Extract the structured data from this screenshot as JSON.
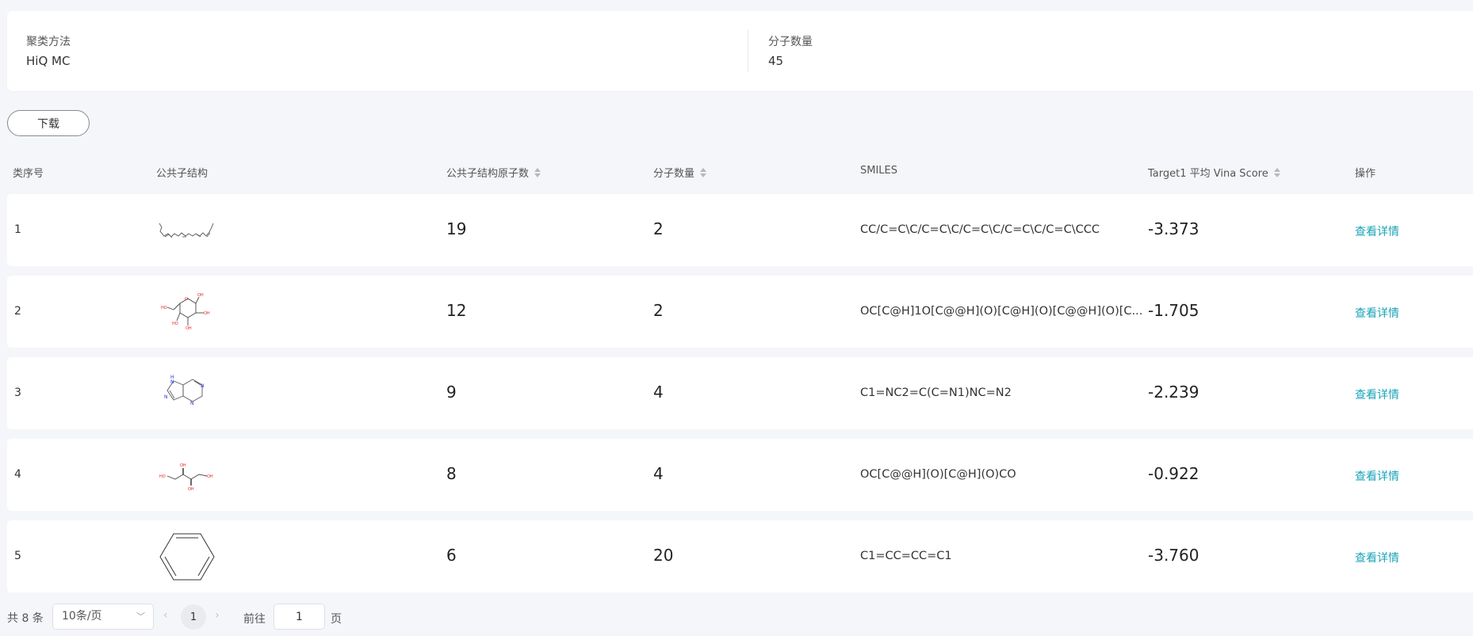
{
  "summary": {
    "method_label": "聚类方法",
    "method_value": "HiQ MC",
    "count_label": "分子数量",
    "count_value": "45"
  },
  "toolbar": {
    "download_label": "下载"
  },
  "table": {
    "headers": {
      "index": "类序号",
      "structure": "公共子结构",
      "atoms": "公共子结构原子数",
      "count": "分子数量",
      "smiles": "SMILES",
      "score": "Target1 平均 Vina Score",
      "action": "操作"
    },
    "rows": [
      {
        "index": "1",
        "structure_icon": "polyene-chain-structure",
        "atoms": "19",
        "count": "2",
        "smiles": "CC/C=C\\C/C=C\\C/C=C\\C/C=C\\C/C=C\\CCC",
        "score": "-3.373",
        "action": "查看详情"
      },
      {
        "index": "2",
        "structure_icon": "pyranose-ring-structure",
        "atoms": "12",
        "count": "2",
        "smiles": "OC[C@H]1O[C@@H](O)[C@H](O)[C@@H](O)[C...",
        "score": "-1.705",
        "action": "查看详情"
      },
      {
        "index": "3",
        "structure_icon": "purine-structure",
        "atoms": "9",
        "count": "4",
        "smiles": "C1=NC2=C(C=N1)NC=N2",
        "score": "-2.239",
        "action": "查看详情"
      },
      {
        "index": "4",
        "structure_icon": "erythritol-structure",
        "atoms": "8",
        "count": "4",
        "smiles": "OC[C@@H](O)[C@H](O)CO",
        "score": "-0.922",
        "action": "查看详情"
      },
      {
        "index": "5",
        "structure_icon": "benzene-ring-structure",
        "atoms": "6",
        "count": "20",
        "smiles": "C1=CC=CC=C1",
        "score": "-3.760",
        "action": "查看详情"
      }
    ]
  },
  "pagination": {
    "total": "共 8 条",
    "page_size": "10条/页",
    "current_page": "1",
    "goto_label": "前往",
    "goto_value": "1",
    "goto_unit": "页"
  },
  "colors": {
    "link": "#1aa3b8",
    "oxygen": "#ee2222",
    "nitrogen": "#2233dd"
  }
}
